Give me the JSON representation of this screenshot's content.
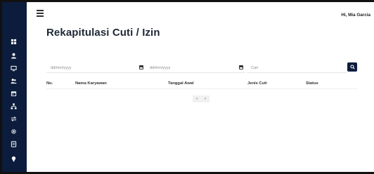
{
  "header": {
    "greeting": "Hi, Mia Garcia"
  },
  "page": {
    "title": "Rekapitulasi Cuti / Izin"
  },
  "filters": {
    "start_date": {
      "placeholder": "dd/mm/yyyy",
      "value": ""
    },
    "end_date": {
      "placeholder": "dd/mm/yyyy",
      "value": ""
    },
    "search": {
      "placeholder": "Cari",
      "value": ""
    }
  },
  "table": {
    "columns": [
      "No.",
      "Nama Karyawan",
      "Tanggal Awal",
      "Jenis Cuti",
      "Status"
    ],
    "rows": []
  },
  "pagination": {
    "prev": "«",
    "next": "»"
  },
  "sidebar": {
    "items": [
      {
        "icon": "grid-icon"
      },
      {
        "icon": "user-icon"
      },
      {
        "icon": "monitor-icon"
      },
      {
        "icon": "users-icon"
      },
      {
        "icon": "calendar-icon"
      },
      {
        "icon": "sitemap-icon"
      },
      {
        "icon": "exchange-icon"
      },
      {
        "icon": "gear-icon"
      },
      {
        "icon": "report-icon"
      },
      {
        "icon": "bulb-icon"
      }
    ]
  },
  "colors": {
    "sidebar": "#0b1c3d",
    "search_button": "#0b1c3d",
    "title": "#1f2937"
  }
}
